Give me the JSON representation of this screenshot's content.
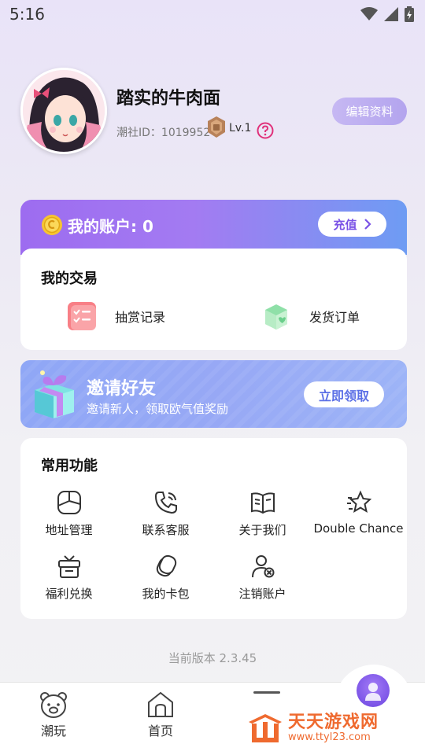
{
  "status_bar": {
    "time": "5:16"
  },
  "profile": {
    "nickname": "踏实的牛肉面",
    "id_text": "潮社ID：1019952",
    "level": "Lv.1",
    "edit_button": "编辑资料"
  },
  "account": {
    "label": "我的账户: 0",
    "recharge_button": "充值"
  },
  "trades": {
    "title": "我的交易",
    "items": [
      {
        "label": "抽赏记录",
        "icon": "checklist-icon"
      },
      {
        "label": "发货订单",
        "icon": "package-icon"
      }
    ]
  },
  "invite": {
    "title": "邀请好友",
    "subtitle": "邀请新人，领取欧气值奖励",
    "button": "立即领取"
  },
  "functions": {
    "title": "常用功能",
    "items": [
      {
        "label": "地址管理",
        "icon": "address-icon"
      },
      {
        "label": "联系客服",
        "icon": "phone-icon"
      },
      {
        "label": "关于我们",
        "icon": "book-icon"
      },
      {
        "label": "Double Chance",
        "icon": "star-icon"
      },
      {
        "label": "福利兑换",
        "icon": "gift-box-icon"
      },
      {
        "label": "我的卡包",
        "icon": "cards-icon"
      },
      {
        "label": "注销账户",
        "icon": "user-remove-icon"
      }
    ]
  },
  "version": "当前版本 2.3.45",
  "tab_bar": {
    "items": [
      {
        "label": "潮玩",
        "icon": "bear-icon"
      },
      {
        "label": "首页",
        "icon": "home-icon"
      }
    ]
  },
  "watermark": {
    "name": "天天游戏网",
    "url": "www.ttyl23.com"
  },
  "colors": {
    "accent_purple": "#9d6cf0",
    "accent_blue": "#6e9cf3",
    "help_pink": "#e0307a",
    "watermark_orange": "#ef6a2f"
  }
}
